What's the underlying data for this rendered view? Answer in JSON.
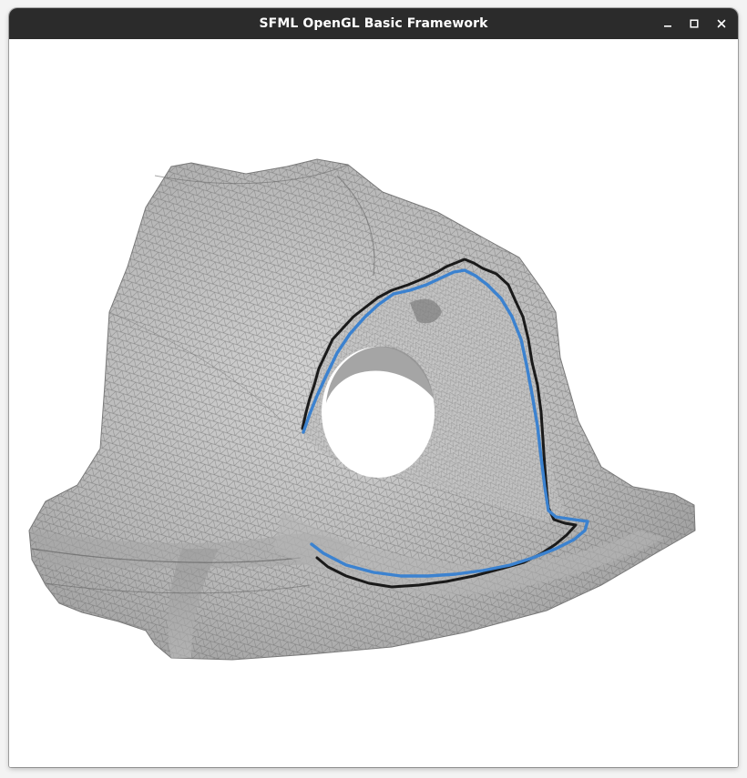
{
  "window": {
    "title": "SFML OpenGL Basic Framework",
    "controls": [
      "minimize-icon",
      "maximize-icon",
      "close-icon"
    ]
  },
  "scene": {
    "background": "#ffffff",
    "mesh_fill": "#9a9a9a",
    "mesh_wire": "#6e6e6e",
    "curves": [
      {
        "name": "",
        "color": "#1a1a1a",
        "icon": "black-path"
      },
      {
        "name": "",
        "color": "#3b82d0",
        "icon": "blue-path"
      }
    ]
  }
}
